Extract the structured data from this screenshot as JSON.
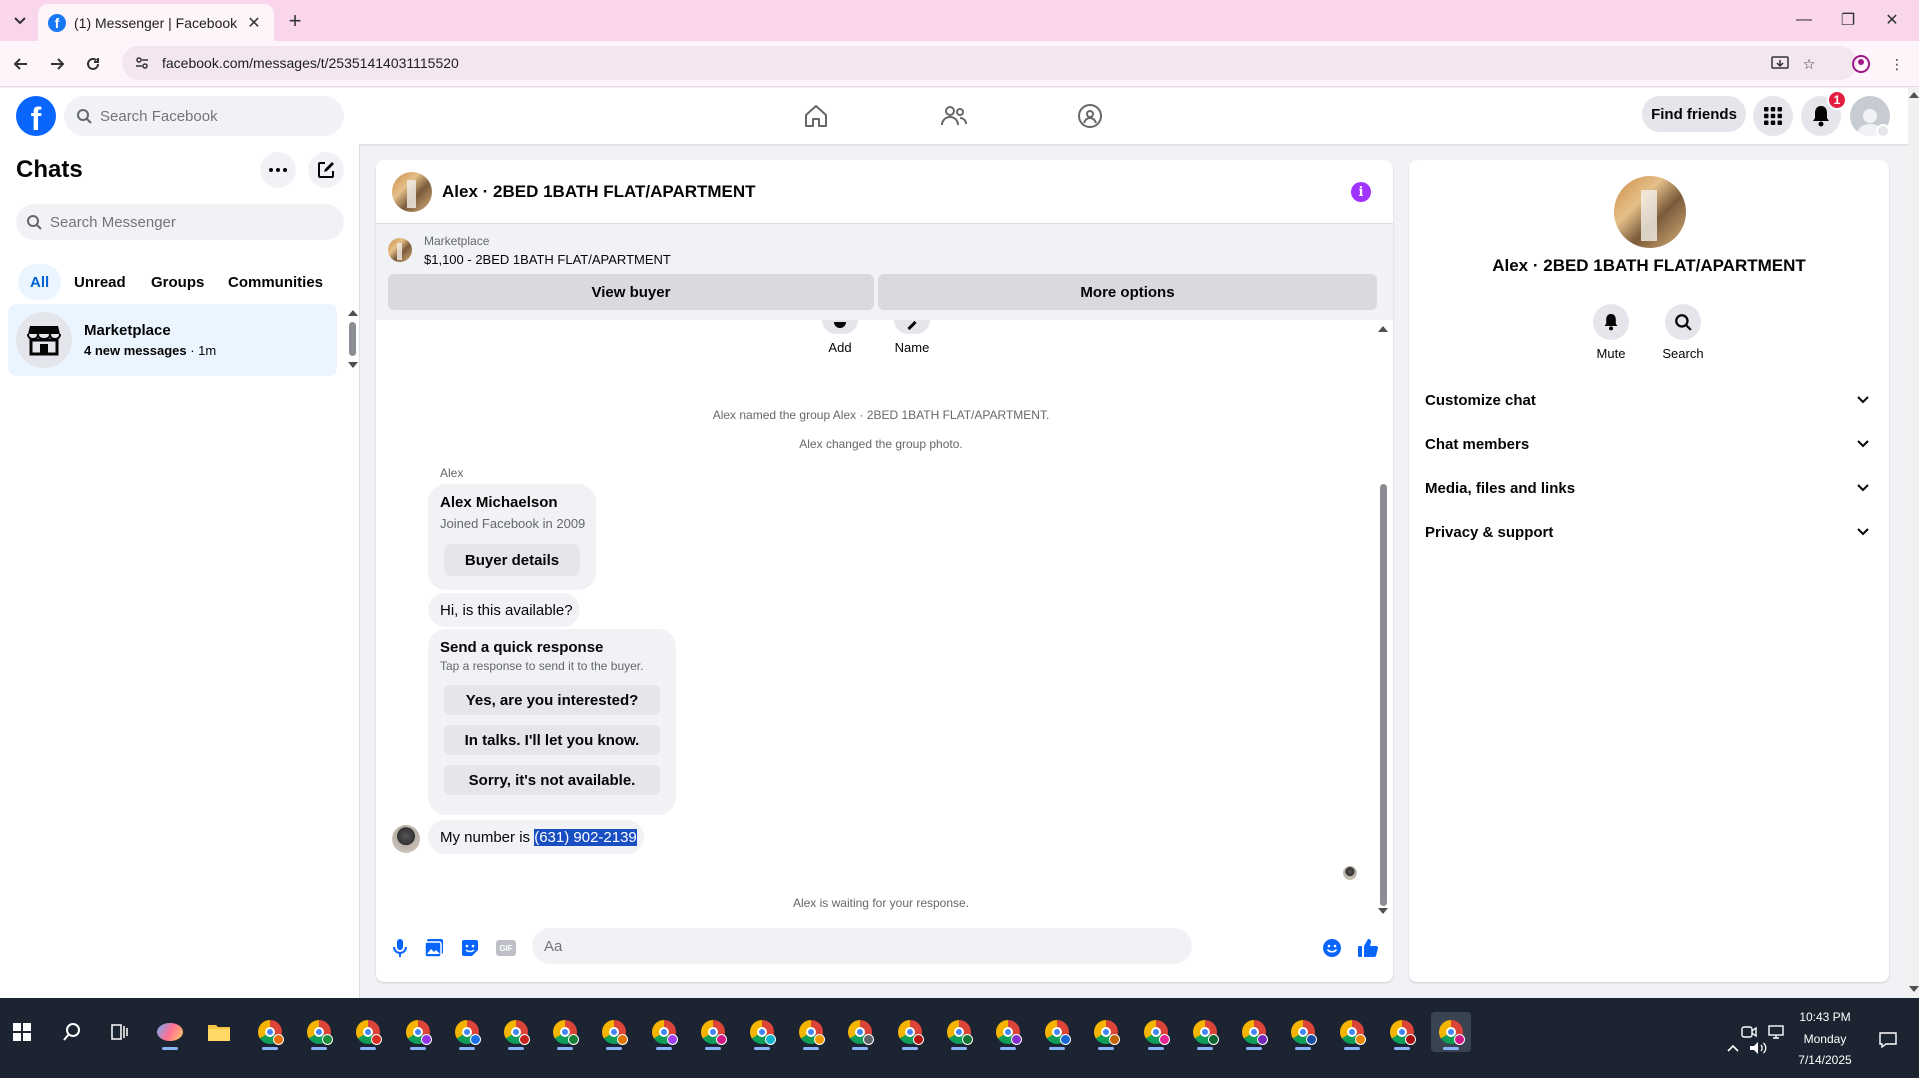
{
  "browser": {
    "tab_title": "(1) Messenger | Facebook",
    "url": "facebook.com/messages/t/25351414031115520"
  },
  "header": {
    "search_placeholder": "Search Facebook",
    "find_friends": "Find friends",
    "notification_count": "1"
  },
  "left": {
    "title": "Chats",
    "search_placeholder": "Search Messenger",
    "filters": [
      "All",
      "Unread",
      "Groups",
      "Communities"
    ],
    "chat": {
      "name": "Marketplace",
      "subtitle_bold": "4 new messages",
      "subtitle_time": " · 1m"
    }
  },
  "conversation": {
    "title": "Alex · 2BED 1BATH FLAT/APARTMENT",
    "marketplace_label": "Marketplace",
    "listing": "$1,100 - 2BED 1BATH FLAT/APARTMENT",
    "view_buyer": "View buyer",
    "more_options": "More options",
    "actions": {
      "add": "Add",
      "name": "Name"
    },
    "system_1": "Alex named the group Alex · 2BED 1BATH FLAT/APARTMENT.",
    "system_2": "Alex changed the group photo.",
    "sender": "Alex",
    "buyer_card": {
      "name": "Alex Michaelson",
      "joined": "Joined Facebook in 2009",
      "button": "Buyer details"
    },
    "message_1": "Hi, is this available?",
    "quick": {
      "title": "Send a quick response",
      "subtitle": "Tap a response to send it to the buyer.",
      "options": [
        "Yes, are you interested?",
        "In talks. I'll let you know.",
        "Sorry, it's not available."
      ]
    },
    "message_2_prefix": "My number is ",
    "message_2_phone": "(631) 902-2139",
    "waiting": "Alex is waiting for your response.",
    "composer_placeholder": "Aa"
  },
  "right": {
    "name": "Alex · 2BED 1BATH FLAT/APARTMENT",
    "mute": "Mute",
    "search": "Search",
    "sections": [
      "Customize chat",
      "Chat members",
      "Media, files and links",
      "Privacy & support"
    ]
  },
  "taskbar": {
    "time": "10:43 PM",
    "day": "Monday",
    "date": "7/14/2025"
  },
  "colors": {
    "facebook_blue": "#0866ff",
    "selected_chat_bg": "#ebf5ff",
    "info_purple": "#a033ff",
    "badge_red": "#e41e3f",
    "selection_highlight": "#1a4fc4"
  },
  "icons": [
    "chevron-down-icon",
    "facebook-favicon",
    "close-icon",
    "plus-icon",
    "minimize-icon",
    "restore-icon",
    "back-arrow-icon",
    "forward-arrow-icon",
    "reload-icon",
    "site-info-icon",
    "install-icon",
    "star-icon",
    "profile-icon",
    "kebab-menu-icon",
    "search-icon",
    "home-icon",
    "friends-icon",
    "groups-icon",
    "menu-grid-icon",
    "bell-icon",
    "more-icon",
    "compose-icon",
    "store-icon",
    "info-icon",
    "microphone-icon",
    "image-icon",
    "sticker-icon",
    "gif-icon",
    "emoji-icon",
    "thumbs-up-icon",
    "windows-start-icon",
    "task-view-icon"
  ]
}
